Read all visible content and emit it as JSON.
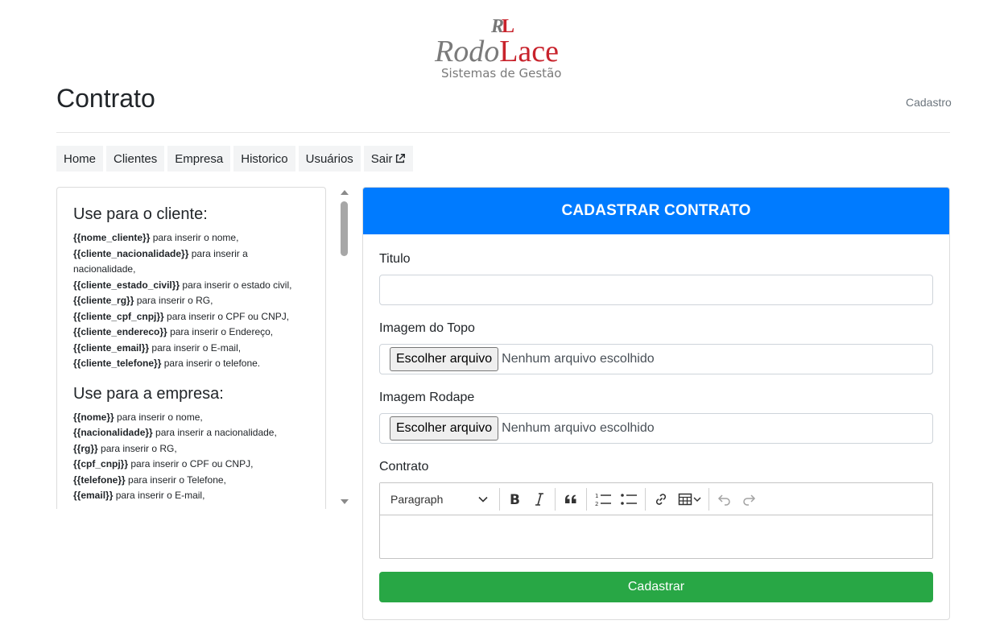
{
  "logo": {
    "mark": "RL",
    "brand_part1": "Rodo",
    "brand_part2": "Lace",
    "tagline": "Sistemas de Gestão"
  },
  "header": {
    "title": "Contrato",
    "breadcrumb": "Cadastro"
  },
  "nav": {
    "items": [
      "Home",
      "Clientes",
      "Empresa",
      "Historico",
      "Usuários",
      "Sair"
    ]
  },
  "info": {
    "client_heading": "Use para o cliente:",
    "client_lines": [
      {
        "tag": "{{nome_cliente}}",
        "desc": " para inserir o nome,"
      },
      {
        "tag": "{{cliente_nacionalidade}}",
        "desc": " para inserir a nacionalidade,"
      },
      {
        "tag": "{{cliente_estado_civil}}",
        "desc": " para inserir o estado civil,"
      },
      {
        "tag": "{{cliente_rg}}",
        "desc": " para inserir o RG,"
      },
      {
        "tag": "{{cliente_cpf_cnpj}}",
        "desc": " para inserir o CPF ou CNPJ,"
      },
      {
        "tag": "{{cliente_endereco}}",
        "desc": " para inserir o Endereço,"
      },
      {
        "tag": "{{cliente_email}}",
        "desc": " para inserir o E-mail,"
      },
      {
        "tag": "{{cliente_telefone}}",
        "desc": " para inserir o telefone."
      }
    ],
    "company_heading": "Use para a empresa:",
    "company_lines": [
      {
        "tag": "{{nome}}",
        "desc": " para inserir o nome,"
      },
      {
        "tag": "{{nacionalidade}}",
        "desc": " para inserir a nacionalidade,"
      },
      {
        "tag": "{{rg}}",
        "desc": " para inserir o RG,"
      },
      {
        "tag": "{{cpf_cnpj}}",
        "desc": " para inserir o CPF ou CNPJ,"
      },
      {
        "tag": "{{telefone}}",
        "desc": " para inserir o Telefone,"
      },
      {
        "tag": "{{email}}",
        "desc": " para inserir o E-mail,"
      }
    ]
  },
  "form": {
    "heading": "CADASTRAR CONTRATO",
    "titulo_label": "Titulo",
    "titulo_value": "",
    "topo_label": "Imagem do Topo",
    "rodape_label": "Imagem Rodape",
    "file_button": "Escolher arquivo",
    "file_none": "Nenhum arquivo escolhido",
    "contrato_label": "Contrato",
    "editor": {
      "paragraph": "Paragraph",
      "icons": [
        "bold-icon",
        "italic-icon",
        "blockquote-icon",
        "numbered-list-icon",
        "bulleted-list-icon",
        "link-icon",
        "table-icon",
        "undo-icon",
        "redo-icon"
      ]
    },
    "submit": "Cadastrar"
  },
  "colors": {
    "primary": "#007bff",
    "success": "#28a745",
    "brand_red": "#c8232c",
    "brand_gray": "#7a7a7a"
  }
}
